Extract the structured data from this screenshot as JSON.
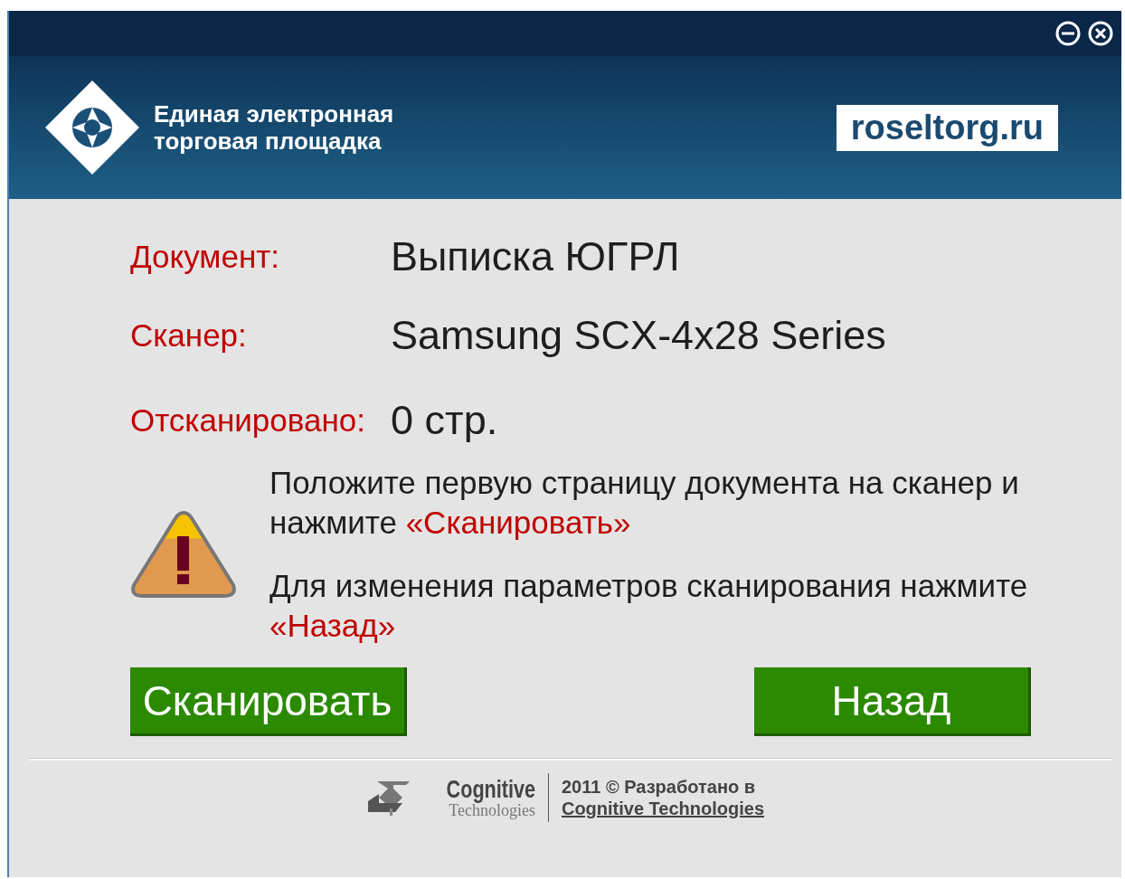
{
  "header": {
    "brand_lines": [
      "Единая электронная",
      "торговая площадка"
    ],
    "site": "roseltorg.ru"
  },
  "fields": [
    {
      "label": "Документ:",
      "value": "Выписка ЮГРЛ"
    },
    {
      "label": "Сканер:",
      "value": "Samsung SCX-4x28 Series"
    },
    {
      "label": "Отсканировано:",
      "value": "0 стр."
    }
  ],
  "messages": [
    {
      "text": "Положите первую страницу документа на сканер и нажмите",
      "highlight": "«Сканировать»"
    },
    {
      "text": "Для изменения параметров сканирования нажмите",
      "highlight": "«Назад»"
    }
  ],
  "buttons": [
    {
      "label": "Сканировать"
    },
    {
      "label": "Назад"
    }
  ],
  "footer": {
    "brand": "Cognitive",
    "brand_sub": "Technologies",
    "copyright": "2011 © Разработано в",
    "link": "Cognitive Technologies"
  }
}
